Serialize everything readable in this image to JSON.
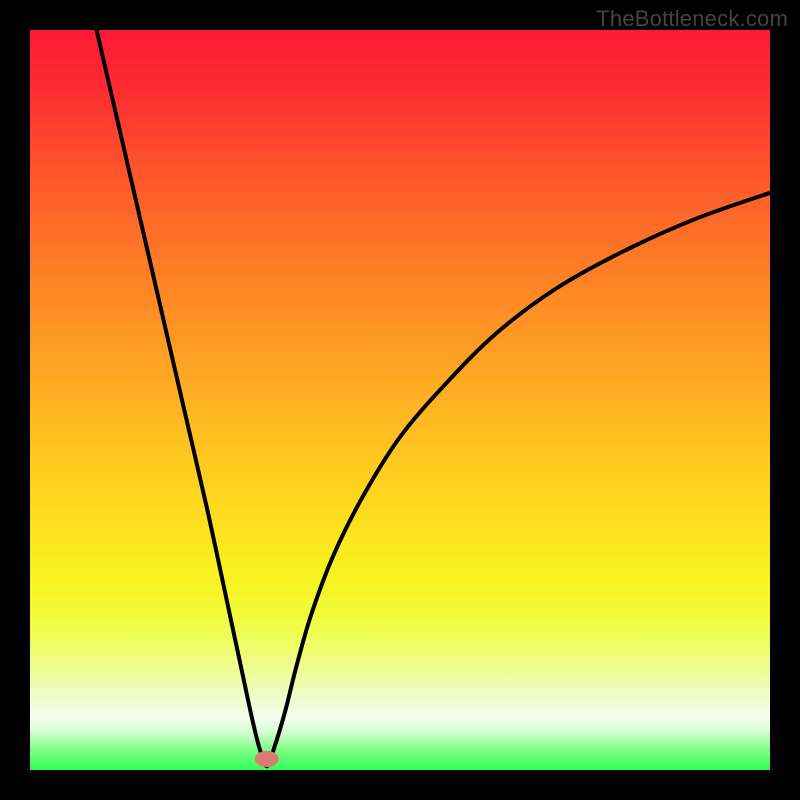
{
  "watermark": "TheBottleneck.com",
  "chart_data": {
    "type": "line",
    "title": "",
    "xlabel": "",
    "ylabel": "",
    "xlim": [
      0,
      1
    ],
    "ylim": [
      0,
      1
    ],
    "notes": "V-shaped bottleneck curve on red-yellow-green gradient. Minimum at x≈0.32 where y≈0. Left branch rises to y≈1 at x≈0.09; right branch rises to y≈0.78 at x=1. Marker dot at the minimum.",
    "series": [
      {
        "name": "bottleneck-curve",
        "x": [
          0.09,
          0.12,
          0.15,
          0.18,
          0.21,
          0.24,
          0.27,
          0.285,
          0.3,
          0.31,
          0.32,
          0.33,
          0.345,
          0.36,
          0.38,
          0.41,
          0.45,
          0.5,
          0.56,
          0.63,
          0.71,
          0.8,
          0.9,
          1.0
        ],
        "y": [
          1.0,
          0.87,
          0.74,
          0.61,
          0.48,
          0.35,
          0.21,
          0.14,
          0.07,
          0.03,
          0.005,
          0.03,
          0.08,
          0.14,
          0.21,
          0.29,
          0.37,
          0.45,
          0.52,
          0.59,
          0.65,
          0.7,
          0.745,
          0.78
        ]
      }
    ],
    "marker": {
      "x": 0.32,
      "y": 0.015,
      "rx": 0.016,
      "ry": 0.011,
      "color": "#d97b6f"
    },
    "gradient_stops": [
      {
        "pos": 0.0,
        "color": "#fd1935"
      },
      {
        "pos": 0.3,
        "color": "#fe7727"
      },
      {
        "pos": 0.55,
        "color": "#fec020"
      },
      {
        "pos": 0.74,
        "color": "#f7f320"
      },
      {
        "pos": 0.9,
        "color": "#effdce"
      },
      {
        "pos": 1.0,
        "color": "#31fd59"
      }
    ]
  }
}
